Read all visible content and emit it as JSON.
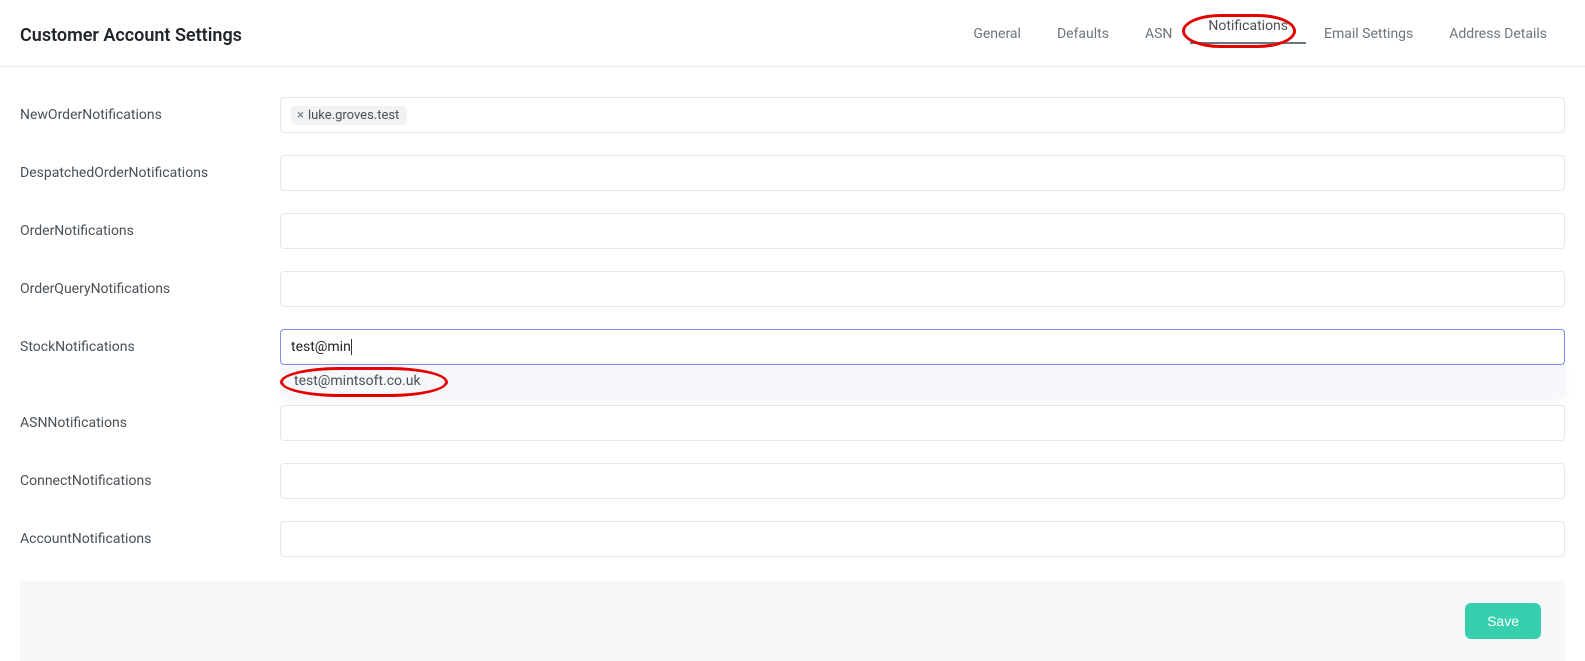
{
  "header": {
    "title": "Customer Account Settings"
  },
  "tabs": [
    {
      "label": "General",
      "id": "general",
      "active": false
    },
    {
      "label": "Defaults",
      "id": "defaults",
      "active": false
    },
    {
      "label": "ASN",
      "id": "asn",
      "active": false
    },
    {
      "label": "Notifications",
      "id": "notifications",
      "active": true
    },
    {
      "label": "Email Settings",
      "id": "email-settings",
      "active": false
    },
    {
      "label": "Address Details",
      "id": "address-details",
      "active": false
    }
  ],
  "fields": {
    "newOrder": {
      "label": "NewOrderNotifications",
      "chips": [
        "luke.groves.test"
      ]
    },
    "despatchedOrder": {
      "label": "DespatchedOrderNotifications"
    },
    "order": {
      "label": "OrderNotifications"
    },
    "orderQuery": {
      "label": "OrderQueryNotifications"
    },
    "stock": {
      "label": "StockNotifications",
      "value": "test@min",
      "suggestion": "test@mintsoft.co.uk"
    },
    "asn": {
      "label": "ASNNotifications"
    },
    "connect": {
      "label": "ConnectNotifications"
    },
    "account": {
      "label": "AccountNotifications"
    }
  },
  "footer": {
    "save_label": "Save"
  },
  "annotations": {
    "tab_highlight": "notifications",
    "suggestion_highlight": true
  }
}
